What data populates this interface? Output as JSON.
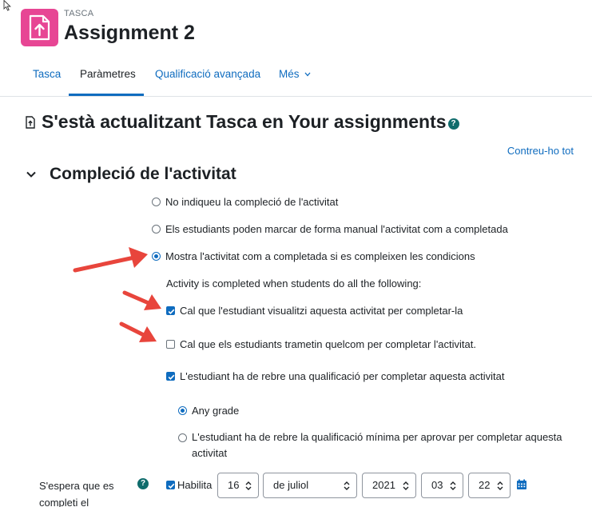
{
  "header": {
    "activity_type": "TASCA",
    "activity_name": "Assignment 2",
    "activity_icon": "assignment-upload-icon",
    "accent_color": "#e74694"
  },
  "nav": {
    "tabs": [
      {
        "label": "Tasca",
        "active": false
      },
      {
        "label": "Paràmetres",
        "active": true
      },
      {
        "label": "Qualificació avançada",
        "active": false
      },
      {
        "label": "Més",
        "active": false
      }
    ]
  },
  "page": {
    "heading": "S'està actualitzant Tasca en Your assignments",
    "help_glyph": "?",
    "collapse_all": "Contreu-ho tot"
  },
  "completion": {
    "section_title": "Compleció de l'activitat",
    "options": [
      {
        "label": "No indiqueu la compleció de l'activitat",
        "checked": false
      },
      {
        "label": "Els estudiants poden marcar de forma manual l'activitat com a completada",
        "checked": false
      },
      {
        "label": "Mostra l'activitat com a completada si es compleixen les condicions",
        "checked": true
      }
    ],
    "conditions_intro": "Activity is completed when students do all the following:",
    "conditions": [
      {
        "label": "Cal que l'estudiant visualitzi aquesta activitat per completar-la",
        "checked": true
      },
      {
        "label": "Cal que els estudiants trametin quelcom per completar l'activitat.",
        "checked": false
      },
      {
        "label": "L'estudiant ha de rebre una qualificació per completar aquesta activitat",
        "checked": true
      }
    ],
    "grade_options": [
      {
        "label": "Any grade",
        "checked": true
      },
      {
        "label_line1": "L'estudiant ha de rebre la qualificació mínima per aprovar per completar aquesta",
        "label_line2": "activitat",
        "checked": false
      }
    ]
  },
  "expected": {
    "label_line1": "S'espera que es",
    "label_line2": "completi el",
    "enable_label": "Habilita",
    "enable_checked": true,
    "day": "16",
    "month": "de juliol",
    "year": "2021",
    "hour": "03",
    "minute": "22"
  },
  "annotation_color": "#e8453c"
}
